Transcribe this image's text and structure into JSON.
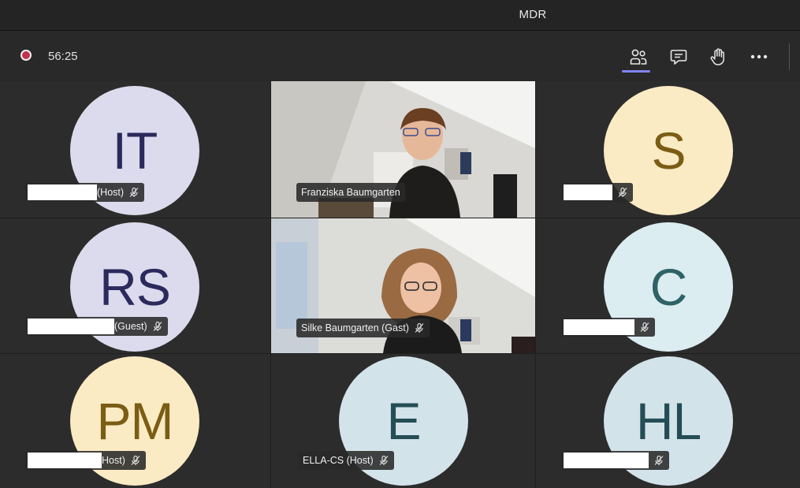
{
  "window": {
    "title": "MDR"
  },
  "toolbar": {
    "recording_time": "56:25",
    "buttons": [
      {
        "name": "participants",
        "icon": "people-icon"
      },
      {
        "name": "chat",
        "icon": "chat-icon"
      },
      {
        "name": "raise-hand",
        "icon": "hand-icon"
      },
      {
        "name": "more",
        "icon": "more-dots-icon"
      }
    ]
  },
  "colors": {
    "lavender": "#dcdbee",
    "lavender_text": "#2b2a5c",
    "yellow": "#fbebc4",
    "yellow_text": "#7a5c14",
    "teal": "#dbedf1",
    "teal_text": "#2f6266",
    "pale_blue": "#d3e3ea",
    "pale_blue_text": "#254d55",
    "recording": "#c4314b",
    "accent": "#7f85f5"
  },
  "participants": [
    {
      "initials": "IT",
      "label": "(Host)",
      "redacted": true
    },
    {
      "initials": "",
      "label": "Franziska Baumgarten",
      "redacted": false,
      "video": true
    },
    {
      "initials": "S",
      "label": "",
      "redacted": true
    },
    {
      "initials": "RS",
      "label": "(Guest)",
      "redacted": true
    },
    {
      "initials": "",
      "label": "Silke Baumgarten (Gast)",
      "redacted": false,
      "video": true
    },
    {
      "initials": "C",
      "label": "",
      "redacted": true
    },
    {
      "initials": "PM",
      "label": "Host)",
      "redacted": true
    },
    {
      "initials": "E",
      "label": "ELLA-CS (Host)",
      "redacted": false
    },
    {
      "initials": "HL",
      "label": "",
      "redacted": true
    }
  ]
}
